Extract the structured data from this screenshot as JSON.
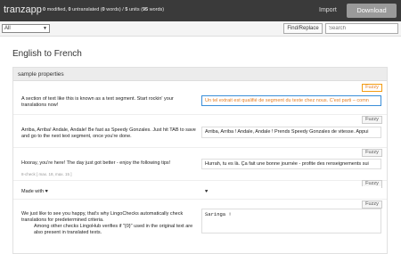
{
  "app": {
    "brand": "tranzapp",
    "stats": {
      "modified": "0",
      "modified_label": " modified, ",
      "untranslated": "0",
      "untranslated_label": " untranslated (",
      "words1": "0",
      "words1_label": " words) / ",
      "units": "5",
      "units_label": " units (",
      "words2": "95",
      "words2_label": " words)"
    },
    "import_label": "Import",
    "download_label": "Download"
  },
  "filter": {
    "selected": "All",
    "findreplace_label": "Find/Replace",
    "search_placeholder": "Search"
  },
  "language_title": "English to French",
  "panel": {
    "title": "sample properties",
    "fuzzy_label": "Fuzzy",
    "segments": [
      {
        "source": "A section of text like this is known as a text segment. Start rockin' your translations now!",
        "target": "Un tel extrait est qualifié de segment du texte chez nous. C'est parti – comn"
      },
      {
        "source": "Arriba, Arriba! Andale, Andale! Be fast as Speedy Gonzales. Just hit TAB to save and go to the next text segment, once you're done.",
        "target": "Arriba, Arriba ! Andale, Andale ! Prends Speedy Gonzales de vitesse. Appui"
      },
      {
        "source": "Hooray, you're here! The day just got better - enjoy the following tips!",
        "target": "Hurrah, tu es là. Ça fait une bonne journée - profite des renseignements sui",
        "meta": "8-check [ max. 18, max. 15 ]"
      },
      {
        "source": "Made with ♥",
        "target": "♥"
      },
      {
        "source_line1": "We just like to see you happy, that's why LingoChecks automatically check translations for predetermined criteria.",
        "source_line2": "Among other checks LingoHub verifies if \"{0}\" used in the original text are also present in translated texts.",
        "target": "Saringa !"
      }
    ]
  }
}
